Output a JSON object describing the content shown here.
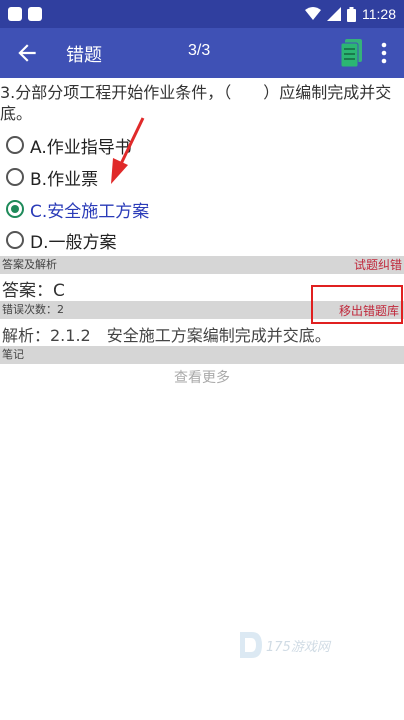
{
  "status_bar": {
    "time": "11:28"
  },
  "app_bar": {
    "title": "错题",
    "pager": "3/3"
  },
  "question": {
    "text": "3.分部分项工程开始作业条件，（　　）应编制完成并交底。"
  },
  "options": [
    {
      "label": "A.作业指导书",
      "selected": false
    },
    {
      "label": "B.作业票",
      "selected": false
    },
    {
      "label": "C.安全施工方案",
      "selected": true
    },
    {
      "label": "D.一般方案",
      "selected": false
    }
  ],
  "answer_section": {
    "header": "答案及解析",
    "correction_link": "试题纠错",
    "answer": "答案：C"
  },
  "error_section": {
    "header": "错误次数：2",
    "remove_button": "移出错题库",
    "analysis": "解析：2.1.2　安全施工方案编制完成并交底。"
  },
  "notes_section": {
    "header": "笔记",
    "more_link": "查看更多"
  },
  "watermark": {
    "text": "175游戏网"
  },
  "colors": {
    "statusbar": "#303f9f",
    "appbar": "#3f51b5",
    "selected": "#1e8a5a",
    "link": "#c0273a",
    "highlight_box": "#e02020"
  }
}
